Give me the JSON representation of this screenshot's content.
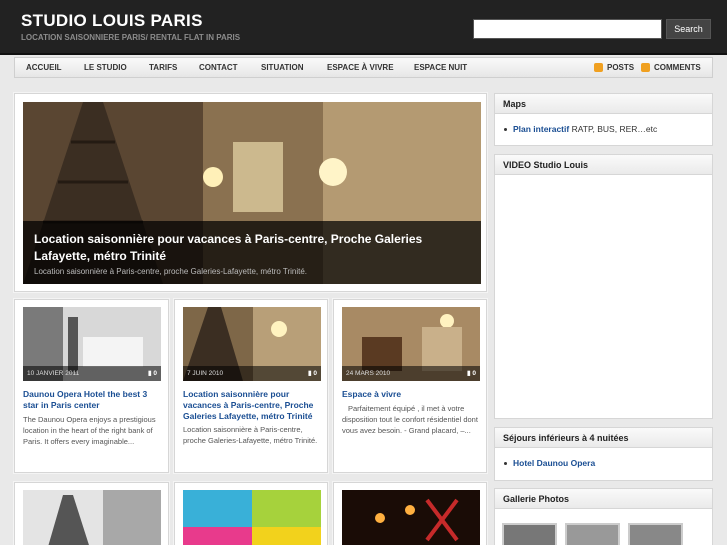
{
  "site": {
    "title": "STUDIO LOUIS PARIS",
    "description": "LOCATION SAISONNIERE PARIS/ RENTAL FLAT IN PARIS"
  },
  "search": {
    "placeholder": "",
    "button": "Search"
  },
  "nav": {
    "items": [
      "ACCUEIL",
      "LE STUDIO",
      "TARIFS",
      "CONTACT",
      "SITUATION",
      "ESPACE À VIVRE",
      "ESPACE NUIT"
    ],
    "posts": "POSTS",
    "comments": "COMMENTS"
  },
  "feature": {
    "title": "Location saisonnière pour vacances à Paris-centre, Proche Galeries Lafayette, métro Trinité",
    "excerpt": "Location saisonnière à Paris-centre, proche Galeries-Lafayette, métro Trinité."
  },
  "posts": [
    {
      "date": "10 JANVIER 2011",
      "comments": "0",
      "title": "Daunou Opera Hotel the best 3 star in Paris center",
      "excerpt": "The Daunou Opera enjoys a prestigious location in the heart of the right bank of Paris. It offers every imaginable..."
    },
    {
      "date": "7 JUIN 2010",
      "comments": "0",
      "title": "Location saisonnière pour vacances à Paris-centre, Proche Galeries Lafayette, métro Trinité",
      "excerpt": "Location saisonnière à Paris-centre, proche Galeries-Lafayette, métro Trinité."
    },
    {
      "date": "24 MARS 2010",
      "comments": "0",
      "title": "Espace à vivre",
      "excerpt": "Parfaitement équipé , il met à votre disposition tout le confort résidentiel dont vous avez besoin.  - Grand placard, –..."
    }
  ],
  "sidebar": {
    "maps": {
      "title": "Maps",
      "link": "Plan interactif",
      "text": " RATP, BUS, RER…etc"
    },
    "video": {
      "title": "VIDEO Studio Louis"
    },
    "sejours": {
      "title": "Séjours inférieurs à 4 nuitées",
      "link": "Hotel Daunou Opera"
    },
    "gallery": {
      "title": "Gallerie Photos"
    }
  },
  "colors": {
    "header": "#222222",
    "link": "#1a4e93",
    "feed": "#f0a020"
  }
}
